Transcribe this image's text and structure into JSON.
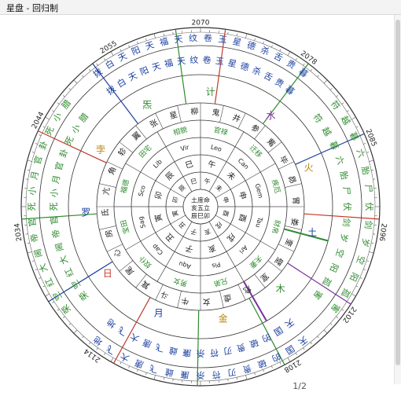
{
  "window": {
    "title": "星盘 - 回归制"
  },
  "pager": {
    "current_page": "1/2"
  },
  "colors": {
    "green": "#2e8b2e",
    "blue": "#1a3fa0",
    "red": "#c0392b",
    "gold": "#b8860b",
    "purple": "#7b2fa0",
    "black": "#222222"
  },
  "chart": {
    "year_labels": [
      "2070",
      "2078",
      "2085",
      "2096",
      "2102",
      "2108",
      "2114",
      "2034",
      "2044",
      "2055"
    ],
    "outer_ring_upper": [
      "拨白天阳天",
      "福天纹卷玉",
      "星德杀舌贵暮"
    ],
    "outer_ring_lower": [
      "天国的破贵",
      "刃符杀廉雌",
      "飞唐大飞地"
    ],
    "outer_ring_left": [
      "荣空红大阃",
      "帝官死小月",
      "官卦死小腊"
    ],
    "outer_ring_right": [
      "符越暮六胎",
      "尸伏剑岁",
      "空阳孤害"
    ],
    "mansion_names": [
      "柳",
      "鬼",
      "井",
      "参",
      "觜",
      "毕",
      "昴",
      "胃",
      "娄",
      "奎",
      "壁",
      "室",
      "危",
      "虚",
      "女",
      "牛",
      "斗",
      "箕",
      "尾",
      "心",
      "房",
      "氐",
      "亢",
      "角",
      "轸",
      "翼",
      "张",
      "星"
    ],
    "planets_ring": [
      "计",
      "水",
      "火",
      "土",
      "木",
      "金",
      "月",
      "日",
      "罗",
      "孛",
      "炁"
    ],
    "palace_ring": [
      "官禄",
      "迁移",
      "疾厄",
      "财帛",
      "夫妻",
      "兄弟",
      "男女",
      "奴仆",
      "宝田",
      "福德",
      "田宅",
      "相貌"
    ],
    "zodiac_ring": [
      "Leo",
      "Can",
      "Gem",
      "Tau",
      "Ari",
      "Pis",
      "Aqu",
      "Cap",
      "Sag",
      "Sco",
      "Lib",
      "Vir"
    ],
    "branches": [
      "午",
      "未",
      "申",
      "酉",
      "戌",
      "亥",
      "子",
      "丑",
      "寅",
      "卯",
      "辰",
      "巳"
    ],
    "center_text": [
      "土度命",
      "亥五立",
      "辰巳卯"
    ]
  }
}
